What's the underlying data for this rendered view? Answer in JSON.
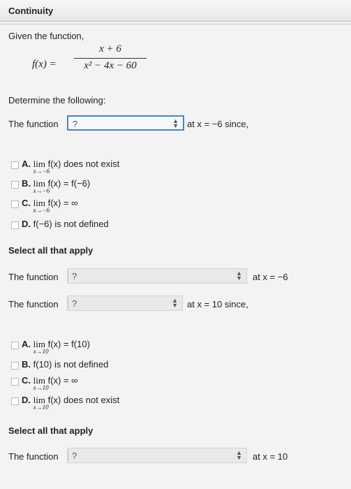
{
  "header": {
    "title": "Continuity"
  },
  "intro": {
    "given": "Given the function,"
  },
  "function": {
    "lhs": "f(x) =",
    "numerator": "x + 6",
    "denominator": "x² − 4x − 60"
  },
  "instruction": "Determine the following:",
  "q1": {
    "prefix": "The function",
    "select_value": "?",
    "suffix": "at x = −6 since,",
    "options": [
      {
        "letter": "A.",
        "lim": "lim",
        "sub": "x→−6",
        "text": "f(x) does not exist"
      },
      {
        "letter": "B.",
        "lim": "lim",
        "sub": "x→−6",
        "text": "f(x) = f(−6)"
      },
      {
        "letter": "C.",
        "lim": "lim",
        "sub": "x→−6",
        "text": "f(x) = ∞"
      },
      {
        "letter": "D.",
        "text": "f(−6) is not defined"
      }
    ],
    "select_all": "Select all that apply"
  },
  "q2": {
    "prefix": "The function",
    "select_value": "?",
    "suffix": "at x = −6"
  },
  "q3": {
    "prefix": "The function",
    "select_value": "?",
    "suffix": "at x = 10 since,",
    "options": [
      {
        "letter": "A.",
        "lim": "lim",
        "sub": "x→10",
        "text": "f(x) = f(10)"
      },
      {
        "letter": "B.",
        "text": "f(10) is not defined"
      },
      {
        "letter": "C.",
        "lim": "lim",
        "sub": "x→10",
        "text": "f(x) = ∞"
      },
      {
        "letter": "D.",
        "lim": "lim",
        "sub": "x→10",
        "text": "f(x) does not exist"
      }
    ],
    "select_all": "Select all that apply"
  },
  "q4": {
    "prefix": "The function",
    "select_value": "?",
    "suffix": "at x = 10"
  }
}
